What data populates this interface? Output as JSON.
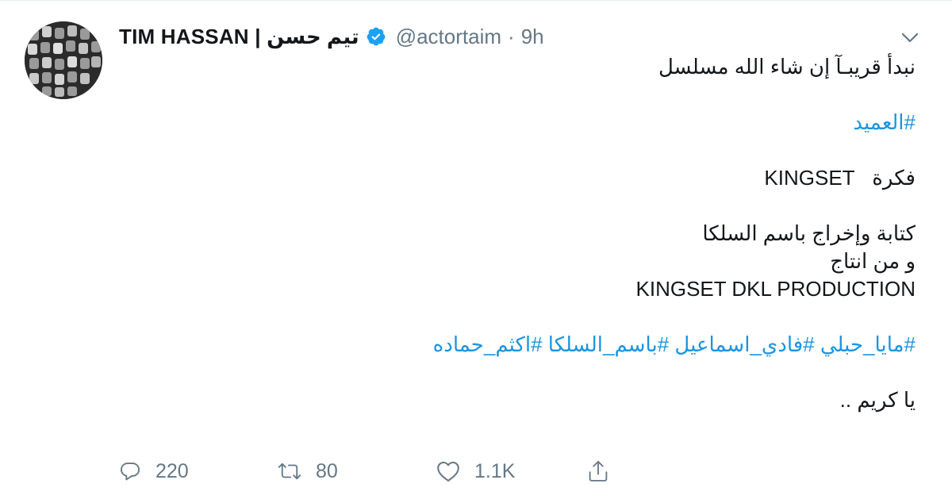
{
  "user": {
    "display_name": "TIM HASSAN | تيم حسن",
    "handle": "@actortaim",
    "separator": "·",
    "time": "9h"
  },
  "tweet": {
    "line1": "نبدأ قريبـآ إن شاء الله مسلسل",
    "hashtag_main": "#العميد",
    "idea_label": "فكرة",
    "idea_value": "KINGSET",
    "writing": "كتابة وإخراج باسم السلكا",
    "production_intro": "و من انتاج",
    "production_company": "KINGSET DKL PRODUCTION",
    "hashtags": [
      "#مايا_حبلي",
      "#فادي_اسماعيل",
      "#باسم_السلكا",
      "#اكثم_حماده"
    ],
    "closing": "يا كريم .."
  },
  "actions": {
    "reply_count": "220",
    "retweet_count": "80",
    "like_count": "1.1K"
  },
  "icons": {
    "verified": "verified-badge-icon",
    "caret": "chevron-down-icon",
    "reply": "reply-icon",
    "retweet": "retweet-icon",
    "like": "heart-icon",
    "share": "share-icon"
  },
  "colors": {
    "link": "#1b95e0",
    "text": "#14171a",
    "muted": "#657786",
    "verified": "#1da1f2"
  }
}
